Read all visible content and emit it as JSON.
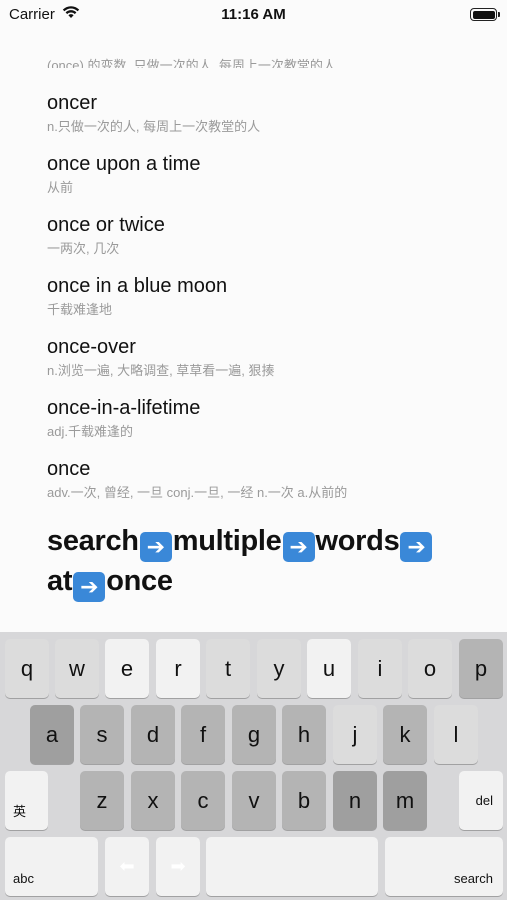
{
  "status_bar": {
    "carrier": "Carrier",
    "time": "11:16 AM"
  },
  "results": {
    "cutoff_text": "(once) 的变数, 只做一次的人, 每周上一次教堂的人",
    "entries": [
      {
        "word": "oncer",
        "definition": "n.只做一次的人, 每周上一次教堂的人"
      },
      {
        "word": "once upon a time",
        "definition": "从前"
      },
      {
        "word": "once or twice",
        "definition": "一两次, 几次"
      },
      {
        "word": "once in a blue moon",
        "definition": "千载难逢地"
      },
      {
        "word": "once-over",
        "definition": "n.浏览一遍, 大略调查, 草草看一遍, 狠揍"
      },
      {
        "word": "once-in-a-lifetime",
        "definition": "adj.千载难逢的"
      },
      {
        "word": "once",
        "definition": "adv.一次, 曾经, 一旦 conj.一旦, 一经 n.一次 a.从前的"
      }
    ]
  },
  "headline": {
    "parts": [
      "search",
      "multiple",
      "words",
      "at",
      "once"
    ],
    "separator_icon": "right-arrow-emoji"
  },
  "keyboard": {
    "row1": [
      "q",
      "w",
      "e",
      "r",
      "t",
      "y",
      "u",
      "i",
      "o",
      "p"
    ],
    "row2": [
      "a",
      "s",
      "d",
      "f",
      "g",
      "h",
      "j",
      "k",
      "l"
    ],
    "row3": [
      "z",
      "x",
      "c",
      "v",
      "b",
      "n",
      "m"
    ],
    "chinese_key": "英",
    "delete_key": "del",
    "abc_key": "abc",
    "left_key": "⬅",
    "right_key": "➡",
    "search_key": "search"
  }
}
